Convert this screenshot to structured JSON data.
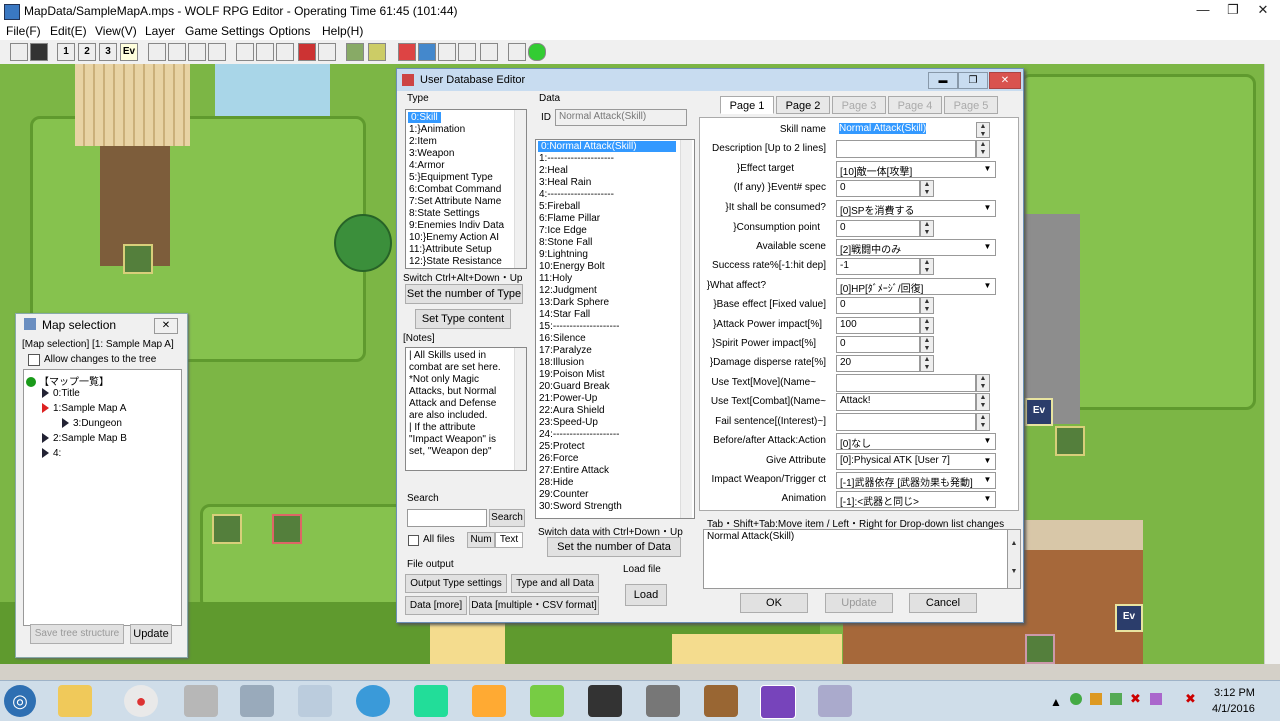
{
  "window": {
    "title": "MapData/SampleMapA.mps - WOLF RPG Editor - Operating Time 61:45 (101:44)",
    "minimize": "—",
    "maximize": "❐",
    "close": "✕"
  },
  "menu": [
    "File(F)",
    "Edit(E)",
    "View(V)",
    "Layer",
    "Game Settings",
    "Options",
    "Help(H)"
  ],
  "toolbar": {
    "layer1": "1",
    "layer2": "2",
    "layer3": "3",
    "ev": "Ev"
  },
  "map": {
    "event_label": "Ev"
  },
  "map_selection": {
    "title": "Map selection",
    "current": "[Map selection] [1: Sample Map A]",
    "allow_changes": "Allow changes to the tree",
    "tree": [
      {
        "label": "【マップ一覧】",
        "indent": 0,
        "icon": "root"
      },
      {
        "label": "0:Title",
        "indent": 1,
        "icon": "arrow"
      },
      {
        "label": "1:Sample Map A",
        "indent": 1,
        "icon": "arrow-red"
      },
      {
        "label": "3:Dungeon",
        "indent": 2,
        "icon": "arrow"
      },
      {
        "label": "2:Sample Map B",
        "indent": 1,
        "icon": "arrow"
      },
      {
        "label": "4:",
        "indent": 1,
        "icon": "arrow"
      }
    ],
    "save_tree": "Save tree structure",
    "update": "Update"
  },
  "editor": {
    "title": "User Database Editor",
    "type_label": "Type",
    "types": [
      "0:Skill",
      "1:}Animation",
      "2:Item",
      "3:Weapon",
      "4:Armor",
      "5:}Equipment Type",
      "6:Combat Command",
      "7:Set Attribute Name",
      "8:State Settings",
      "9:Enemies Indiv Data",
      "10:}Enemy Action AI",
      "11:}Attribute Setup",
      "12:}State Resistance"
    ],
    "switch_type": "Switch Ctrl+Alt+Down・Up",
    "set_number_type": "Set the number of Type",
    "set_type_content": "Set Type content",
    "notes_label": "[Notes]",
    "notes": [
      "| All Skills used in",
      "combat are set here.",
      "*Not only Magic",
      "Attacks, but Normal",
      "Attack and Defense",
      "are also included.",
      "| If the attribute",
      "\"Impact Weapon\" is",
      "set, \"Weapon dep\""
    ],
    "search_label": "Search",
    "search_button": "Search",
    "all_files": "All files",
    "num": "Num",
    "text": "Text",
    "file_output": "File output",
    "output_type_settings": "Output Type settings",
    "type_and_all_data": "Type and all Data",
    "data_more": "Data [more]",
    "data_multiple": "Data [multiple・CSV format]",
    "load_file": "Load file",
    "load": "Load",
    "data_label": "Data",
    "id_label": "ID",
    "id_value": "Normal Attack(Skill)",
    "data_items": [
      "0:Normal Attack(Skill)",
      "1:--------------------",
      "2:Heal",
      "3:Heal Rain",
      "4:--------------------",
      "5:Fireball",
      "6:Flame Pillar",
      "7:Ice Edge",
      "8:Stone Fall",
      "9:Lightning",
      "10:Energy Bolt",
      "11:Holy",
      "12:Judgment",
      "13:Dark Sphere",
      "14:Star Fall",
      "15:--------------------",
      "16:Silence",
      "17:Paralyze",
      "18:Illusion",
      "19:Poison Mist",
      "20:Guard Break",
      "21:Power-Up",
      "22:Aura Shield",
      "23:Speed-Up",
      "24:--------------------",
      "25:Protect",
      "26:Force",
      "27:Entire Attack",
      "28:Hide",
      "29:Counter",
      "30:Sword Strength"
    ],
    "switch_data": "Switch data with Ctrl+Down・Up",
    "set_number_data": "Set the number of Data",
    "pages": [
      "Page 1",
      "Page 2",
      "Page 3",
      "Page 4",
      "Page 5"
    ],
    "fields": [
      {
        "label": "Skill name",
        "value": "Normal Attack(Skill)",
        "kind": "text-sel"
      },
      {
        "label": "Description [Up to 2 lines]",
        "value": "",
        "kind": "text"
      },
      {
        "label": "}Effect target",
        "value": "[10]敵一体[攻撃]",
        "kind": "dropdown"
      },
      {
        "label": "(If any) }Event# spec",
        "value": "0",
        "kind": "spin"
      },
      {
        "label": "}It shall be consumed?",
        "value": "[0]SPを消費する",
        "kind": "dropdown"
      },
      {
        "label": "}Consumption point",
        "value": "0",
        "kind": "spin"
      },
      {
        "label": "Available scene",
        "value": "[2]戦闘中のみ",
        "kind": "dropdown"
      },
      {
        "label": "Success rate%[-1:hit dep]",
        "value": "-1",
        "kind": "spin"
      },
      {
        "label": "}What affect?",
        "value": "[0]HP[ﾀﾞﾒｰｼﾞ/回復]",
        "kind": "dropdown"
      },
      {
        "label": "}Base effect [Fixed value]",
        "value": "0",
        "kind": "spin"
      },
      {
        "label": "}Attack Power impact[%]",
        "value": "100",
        "kind": "spin"
      },
      {
        "label": "}Spirit Power impact[%]",
        "value": "0",
        "kind": "spin"
      },
      {
        "label": "}Damage disperse rate[%]",
        "value": "20",
        "kind": "spin"
      },
      {
        "label": "Use Text[Move](Name~",
        "value": "",
        "kind": "text"
      },
      {
        "label": "Use Text[Combat](Name~",
        "value": "Attack!",
        "kind": "text"
      },
      {
        "label": "Fail sentence[(Interest)~]",
        "value": "",
        "kind": "text"
      },
      {
        "label": "Before/after Attack:Action",
        "value": "[0]なし",
        "kind": "dropdown"
      },
      {
        "label": "Give Attribute",
        "value": "[0]:Physical ATK [User 7]",
        "kind": "dropdown"
      },
      {
        "label": "Impact Weapon/Trigger ct",
        "value": "[-1]武器依存 [武器効果も発動]",
        "kind": "dropdown"
      },
      {
        "label": "Animation",
        "value": "[-1]:<武器と同じ>",
        "kind": "dropdown"
      }
    ],
    "hint": "Tab・Shift+Tab:Move item / Left・Right for Drop-down list changes",
    "memo": "Normal Attack(Skill)",
    "ok": "OK",
    "update": "Update",
    "cancel": "Cancel"
  },
  "taskbar": {
    "time": "3:12 PM",
    "date": "4/1/2016"
  }
}
